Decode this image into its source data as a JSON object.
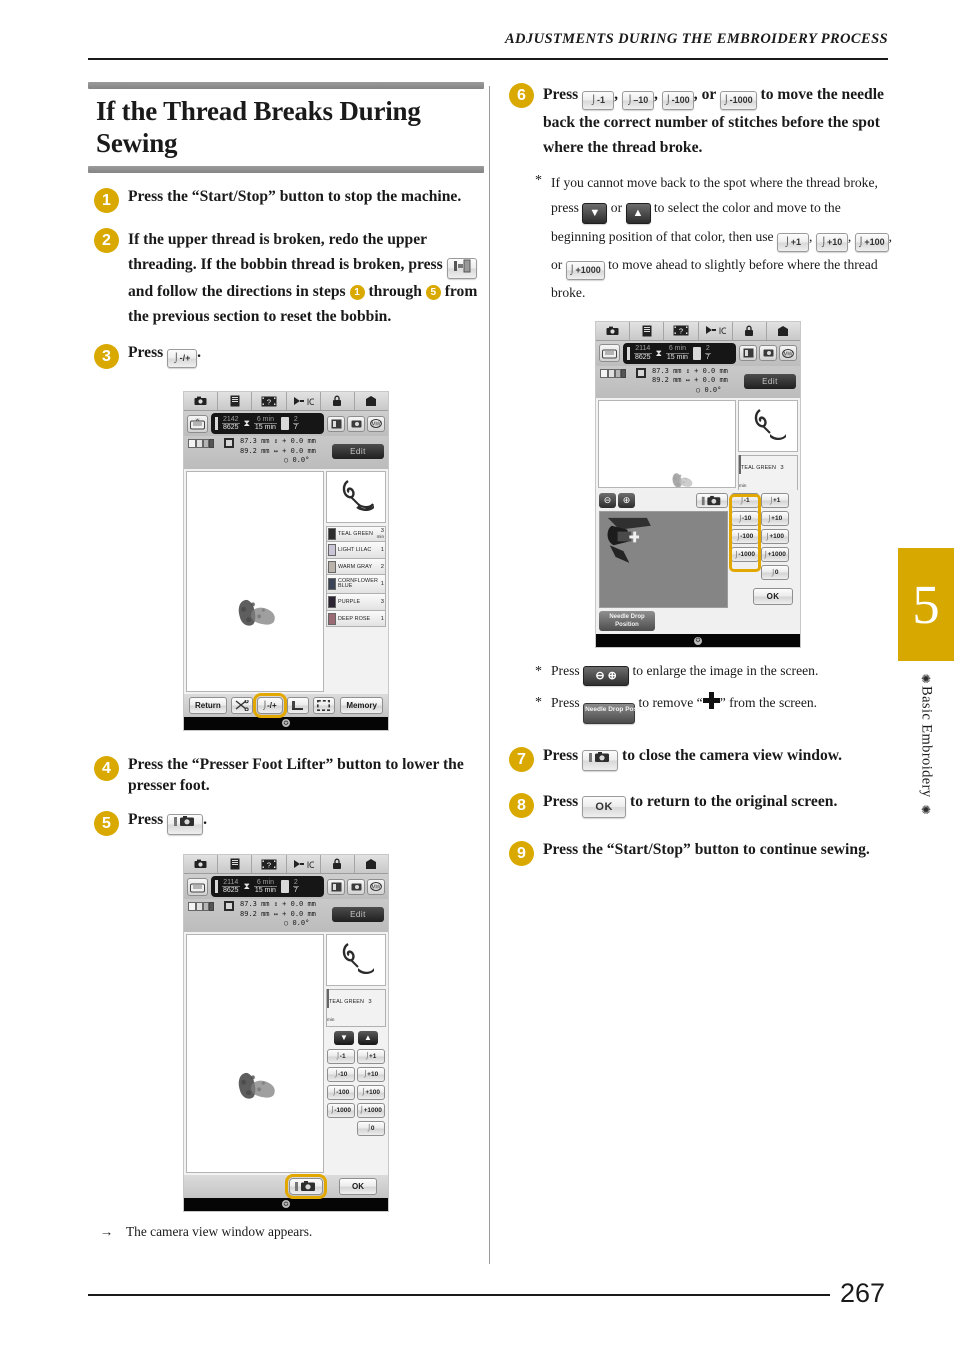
{
  "header": {
    "running_head": "ADJUSTMENTS DURING THE EMBROIDERY PROCESS"
  },
  "page": {
    "number": "267"
  },
  "chapter_tab": {
    "number": "5",
    "label": "Basic Embroidery",
    "ornament": "✺"
  },
  "section": {
    "title": "If the Thread Breaks During Sewing"
  },
  "steps": [
    {
      "num": "1",
      "text_a": "Press the “Start/Stop” button to stop the machine."
    },
    {
      "num": "2",
      "text_a": "If the upper thread is broken, redo the upper threading. If the bobbin thread is broken, press",
      "text_b": "and follow the directions in steps",
      "ref1": "1",
      "text_c": "through",
      "ref2": "5",
      "text_d": "from the previous section to reset the bobbin.",
      "icon": "bobbin-winding-icon"
    },
    {
      "num": "3",
      "text_a": "Press",
      "key": "-/+",
      "text_b": "."
    },
    {
      "num": "4",
      "text_a": "Press the “Presser Foot Lifter” button to lower the presser foot."
    },
    {
      "num": "5",
      "text_a": "Press",
      "key": "camera-icon",
      "text_b": "."
    },
    {
      "num": "6",
      "text_a": "Press",
      "k1": "-1",
      "sep1": ",",
      "k2": "–10",
      "sep2": ",",
      "k3": "-100",
      "sep3": ", or",
      "k4": "-1000",
      "text_b": "to move the needle back the correct number of stitches before the spot where the thread broke."
    },
    {
      "num": "7",
      "text_a": "Press",
      "key": "camera-icon",
      "text_b": "to close the camera view window."
    },
    {
      "num": "8",
      "text_a": "Press",
      "key": "OK",
      "text_b": "to return to the original screen."
    },
    {
      "num": "9",
      "text_a": "Press the “Start/Stop” button to continue sewing."
    }
  ],
  "notes": {
    "step6_note": {
      "marker": "*",
      "a": "If you cannot move back to the spot where the thread broke, press",
      "b": "or",
      "c": "to select the color and move to the beginning position of that color,",
      "d": "then use",
      "k1": "+1",
      "s1": ",",
      "k2": "+10",
      "s2": ",",
      "k3": "+100",
      "s3": ", or",
      "k4": "+1000",
      "e": "to move ahead to slightly before where the thread broke.",
      "down_icon": "color-down-arrow-icon",
      "up_icon": "color-up-arrow-icon"
    },
    "camera_note_1": {
      "marker": "*",
      "a": "Press",
      "b": "to enlarge the image in the screen.",
      "icon": "zoom-out-in-icon"
    },
    "camera_note_2": {
      "marker": "*",
      "a": "Press",
      "b": "to remove “",
      "c": "” from the screen.",
      "icon": "needle-drop-position-icon",
      "glyph": "plus-crosshair"
    }
  },
  "caption": {
    "arrow": "→",
    "text": "The camera view window appears."
  },
  "machine_screen": {
    "tabs": [
      "camera-tab-icon",
      "document-tab-icon",
      "guide-tab-icon",
      "needle-thread-tab-icon",
      "lock-tab-icon",
      "home-tab-icon"
    ],
    "info": {
      "mode_icon": "embroidery-mode-icon",
      "stitch_count_top": "2142",
      "stitch_count_bottom": "8625",
      "stitch_count_top_alt": "2114",
      "time_top": "6 min",
      "time_bottom": "15 min",
      "color_top": "2",
      "color_bottom": "7",
      "right_icons": [
        "needle-guide-icon",
        "camera-settings-icon",
        "mw-icon"
      ]
    },
    "dimensions": {
      "width": "87.3 mm",
      "height": "89.2 mm",
      "offset_v": "0.0 mm",
      "offset_h": "0.0 mm",
      "rotation": "0.0°",
      "v_symbol": "↕",
      "h_symbol": "↔",
      "rot_symbol": "○"
    },
    "edit_button": "Edit",
    "colors": [
      {
        "name": "TEAL GREEN",
        "num": "3",
        "unit": "min",
        "hex": "#2d2d2d"
      },
      {
        "name": "LIGHT LILAC",
        "num": "1",
        "unit": "",
        "hex": "#c9c5d6"
      },
      {
        "name": "WARM GRAY",
        "num": "2",
        "unit": "",
        "hex": "#b9b3ab"
      },
      {
        "name": "CORNFLOWER BLUE",
        "num": "1",
        "unit": "",
        "hex": "#3a4456"
      },
      {
        "name": "PURPLE",
        "num": "3",
        "unit": "",
        "hex": "#2c2433"
      },
      {
        "name": "DEEP ROSE",
        "num": "1",
        "unit": "",
        "hex": "#9a6b74"
      }
    ],
    "selected_color": {
      "name": "TEAL GREEN",
      "num": "3",
      "unit": "min"
    },
    "nav_arrows": {
      "down": "▼",
      "up": "▲"
    },
    "stitch_buttons": [
      "-1",
      "+1",
      "-10",
      "+10",
      "-100",
      "+100",
      "-1000",
      "+1000",
      "0"
    ],
    "ok_button": "OK",
    "bottom_bar": {
      "return": "Return",
      "scissors": "thread-cut-icon",
      "needle_plus_minus": "needle-position-icon",
      "presser_foot": "presser-foot-icon",
      "frame": "hoop-frame-icon",
      "memory": "Memory"
    },
    "camera_view": {
      "zoom_out": "zoom-out-icon",
      "zoom_in": "zoom-in-icon",
      "camera_close": "camera-icon",
      "needle_drop_position": "Needle Drop Position"
    }
  }
}
